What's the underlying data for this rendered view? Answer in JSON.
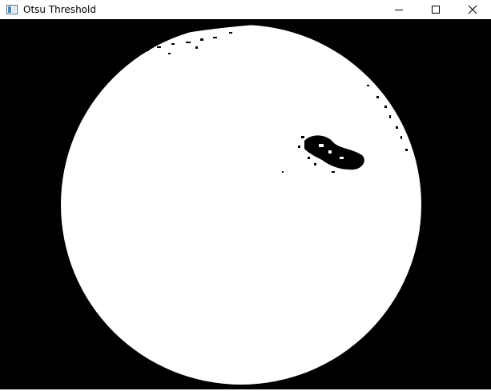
{
  "window": {
    "title": "Otsu Threshold",
    "controls": {
      "minimize": "minimize-icon",
      "maximize": "maximize-icon",
      "close": "close-icon"
    }
  },
  "image": {
    "description_free": true,
    "foreground_color": "#ffffff",
    "background_color": "#000000"
  }
}
